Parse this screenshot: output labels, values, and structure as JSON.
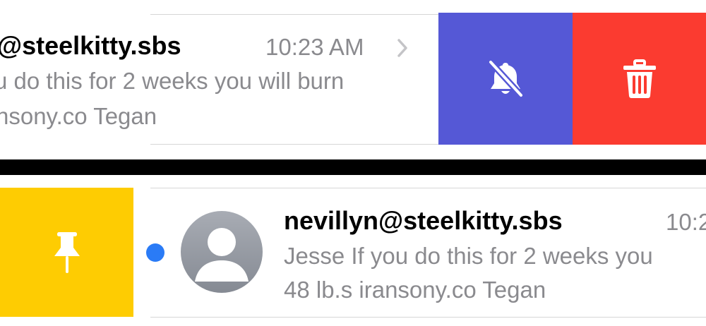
{
  "colors": {
    "mute_action": "#5558d6",
    "delete_action": "#fb3b30",
    "pin_action": "#fecc02",
    "unread_dot": "#2a7bf6",
    "secondary_text": "#8a8a8e"
  },
  "top_row": {
    "sender": "@steelkitty.sbs",
    "time": "10:23 AM",
    "preview_line1": "u do this for 2 weeks you will burn",
    "preview_line2": "nsony.co Tegan",
    "actions": [
      {
        "name": "mute",
        "icon": "bell-slash-icon"
      },
      {
        "name": "delete",
        "icon": "trash-icon"
      }
    ]
  },
  "bottom_row": {
    "sender": "nevillyn@steelkitty.sbs",
    "time": "10:2",
    "preview_line1": "Jesse If you do this for 2 weeks you",
    "preview_line2": "48 lb.s iransony.co Tegan",
    "unread": true,
    "actions": [
      {
        "name": "pin",
        "icon": "pin-icon"
      }
    ]
  }
}
